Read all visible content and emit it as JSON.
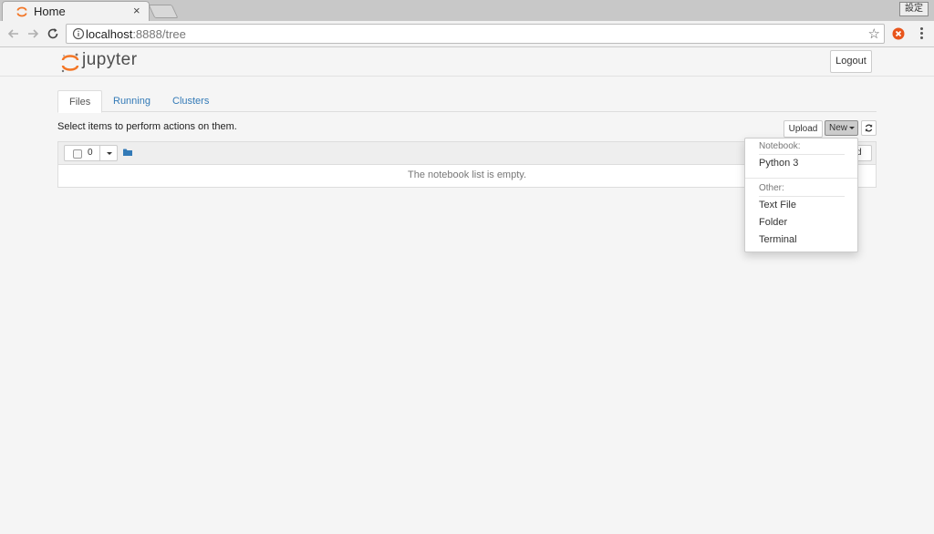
{
  "browser": {
    "tab_title": "Home",
    "tab_close": "×",
    "url_host": "localhost",
    "url_path": ":8888/tree",
    "corner_badge": "設定"
  },
  "header": {
    "logo_text": "jupyter",
    "logout_label": "Logout"
  },
  "tabs": [
    {
      "label": "Files",
      "active": true
    },
    {
      "label": "Running",
      "active": false
    },
    {
      "label": "Clusters",
      "active": false
    }
  ],
  "toolbar": {
    "hint": "Select items to perform actions on them.",
    "upload_label": "Upload",
    "new_label": "New"
  },
  "list": {
    "selected_count": "0",
    "partial_button_label": "d",
    "empty_message": "The notebook list is empty."
  },
  "new_menu": {
    "notebook_header": "Notebook:",
    "notebook_items": [
      "Python 3"
    ],
    "other_header": "Other:",
    "other_items": [
      "Text File",
      "Folder",
      "Terminal"
    ]
  },
  "colors": {
    "jupyter_orange": "#f37626",
    "link_blue": "#337ab7",
    "extension_icon": "#e8541b"
  },
  "icons": [
    "jupyter-favicon",
    "back-arrow-icon",
    "forward-arrow-icon",
    "reload-icon",
    "info-icon",
    "star-icon",
    "extension-icon",
    "menu-dots-icon",
    "refresh-icon",
    "folder-icon",
    "caret-down-icon"
  ]
}
